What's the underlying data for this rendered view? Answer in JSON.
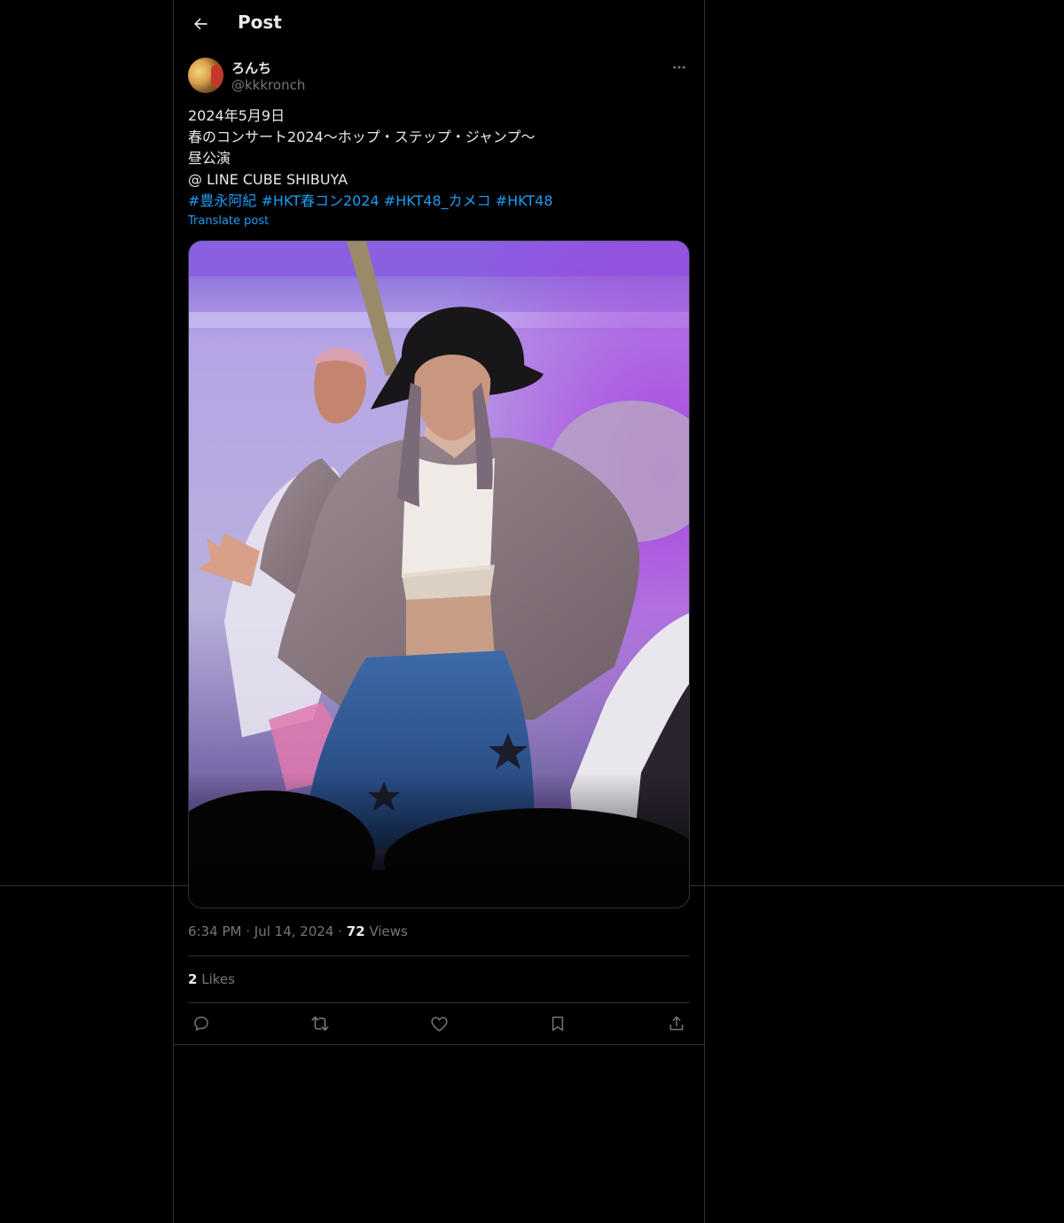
{
  "header": {
    "title": "Post",
    "back_icon": "arrow-left-icon"
  },
  "author": {
    "display_name": "ろんち",
    "handle": "@kkkronch"
  },
  "post": {
    "lines": [
      "2024年5月9日",
      "春のコンサート2024〜ホップ・ステップ・ジャンプ〜",
      "昼公演",
      "@ LINE CUBE SHIBUYA"
    ],
    "hashtags": [
      "#豊永阿紀",
      "#HKT春コン2024",
      "#HKT48_カメコ",
      "#HKT48"
    ],
    "translate_label": "Translate post"
  },
  "meta": {
    "time": "6:34 PM",
    "date": "Jul 14, 2024",
    "views_count": "72",
    "views_label": "Views"
  },
  "stats": {
    "likes_count": "2",
    "likes_label": "Likes"
  },
  "actions": [
    "reply-icon",
    "repost-icon",
    "like-icon",
    "bookmark-icon",
    "share-icon"
  ],
  "colors": {
    "background": "#000000",
    "text": "#e7e9ea",
    "muted": "#71767b",
    "link": "#1d9bf0",
    "border": "#2f3336"
  }
}
